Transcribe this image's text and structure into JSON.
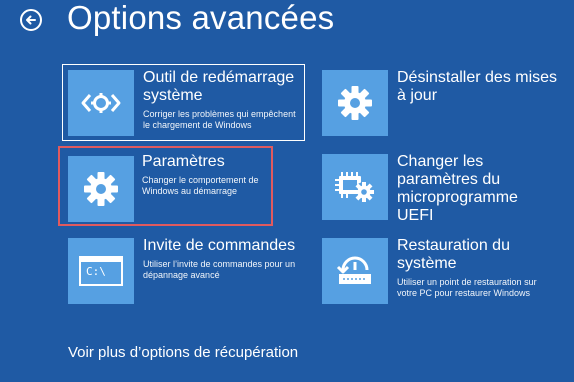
{
  "header": {
    "title": "Options avancées",
    "back_icon": "back-arrow-icon"
  },
  "tiles": [
    {
      "id": "startup-repair",
      "title": "Outil de redémarrage\nsystème",
      "desc": "Corriger les problèmes qui empêchent\nle chargement de Windows",
      "icon": "startup-repair-icon"
    },
    {
      "id": "uninstall-updates",
      "title": "Désinstaller des mises\nà jour",
      "desc": "",
      "icon": "gear-icon"
    },
    {
      "id": "startup-settings",
      "title": "Paramètres",
      "desc": "Changer le comportement de\nWindows au démarrage",
      "icon": "gear-icon"
    },
    {
      "id": "uefi-settings",
      "title": "Changer les\nparamètres du\nmicroprogramme\nUEFI",
      "desc": "",
      "icon": "chip-gear-icon"
    },
    {
      "id": "command-prompt",
      "title": "Invite de commandes",
      "desc": "Utiliser l’invite de commandes pour un\ndépannage avancé",
      "icon": "command-prompt-icon",
      "prompt_text": "C:\\"
    },
    {
      "id": "system-restore",
      "title": "Restauration du\nsystème",
      "desc": "Utiliser un point de restauration sur\nvotre PC pour restaurer Windows",
      "icon": "system-restore-icon"
    }
  ],
  "footer": {
    "more_link": "Voir plus d’options de récupération"
  },
  "colors": {
    "background": "#1f5aa4",
    "tile_icon": "#56a0e2",
    "highlight": "#e05a5e"
  }
}
